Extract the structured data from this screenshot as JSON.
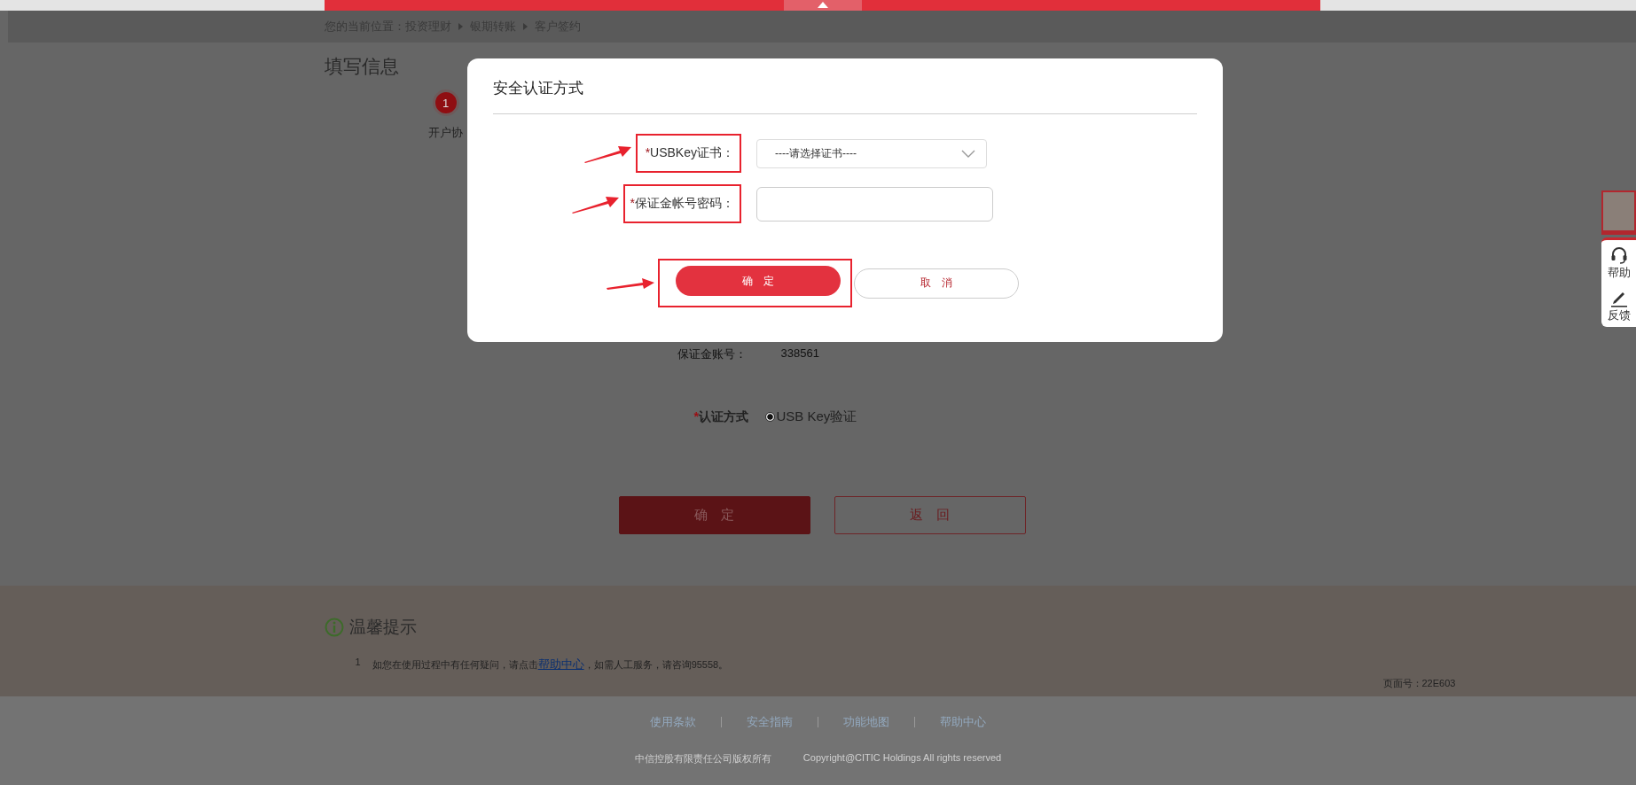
{
  "breadcrumb": {
    "label": "您的当前位置：",
    "items": [
      "投资理财",
      "银期转账",
      "客户签约"
    ]
  },
  "page_title": "填写信息",
  "steps": [
    {
      "number": "1",
      "label": "开户协",
      "selected": true
    }
  ],
  "form": {
    "fields": [
      {
        "label": "保证金账号：",
        "value": "338561"
      }
    ],
    "auth": {
      "label": "认证方式",
      "required_mark": "*",
      "options": [
        {
          "label": "USB Key验证",
          "selected": true
        }
      ]
    }
  },
  "buttons": [
    {
      "label": "确　定",
      "kind": "primary"
    },
    {
      "label": "返　回",
      "kind": "secondary"
    }
  ],
  "tips": {
    "title": "温馨提示",
    "items": [
      {
        "number": "1",
        "before": "如您在使用过程中有任何疑问，请点击",
        "link": "帮助中心",
        "after": "，如需人工服务，请咨询95558。"
      }
    ]
  },
  "page_number": "页面号：22E603",
  "footer": {
    "links": [
      "使用条款",
      "安全指南",
      "功能地图",
      "帮助中心"
    ],
    "company": "中信控股有限责任公司版权所有",
    "copyright": "Copyright@CITIC Holdings All rights reserved"
  },
  "side_widget": {
    "items": [
      {
        "kind": "headset",
        "label": "帮助"
      },
      {
        "kind": "pencil",
        "label": "反馈"
      }
    ]
  },
  "dialog": {
    "title": "安全认证方式",
    "fields": [
      {
        "kind": "select",
        "label": "USBKey证书：",
        "required_mark": "*",
        "highlighted": true,
        "value": "----请选择证书----"
      },
      {
        "kind": "password",
        "label": "保证金帐号密码：",
        "required_mark": "*",
        "highlighted": true
      }
    ],
    "buttons": [
      {
        "label": "确　定",
        "kind": "primary",
        "highlighted": true
      },
      {
        "label": "取　消",
        "kind": "secondary",
        "highlighted": false
      }
    ]
  }
}
